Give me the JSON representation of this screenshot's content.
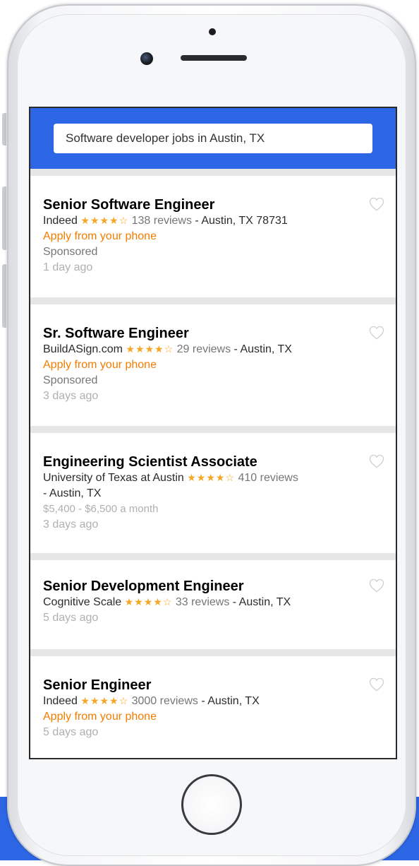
{
  "search": {
    "query": "Software developer jobs in Austin, TX"
  },
  "jobs": [
    {
      "title": "Senior Software Engineer",
      "company": "Indeed",
      "stars": "★★★★☆",
      "reviews": "138 reviews",
      "location": " - Austin, TX 78731",
      "apply": "Apply from your phone",
      "sponsored": "Sponsored",
      "posted": "1 day ago"
    },
    {
      "title": "Sr. Software Engineer",
      "company": "BuildASign.com",
      "stars": "★★★★☆",
      "reviews": "29 reviews",
      "location": " - Austin, TX",
      "apply": "Apply from your phone",
      "sponsored": "Sponsored",
      "posted": "3 days ago"
    },
    {
      "title": "Engineering Scientist Associate",
      "company": "University of Texas at Austin",
      "stars": "★★★★☆",
      "reviews": "410 reviews",
      "location": "- Austin, TX",
      "salary": "$5,400 - $6,500 a month",
      "posted": "3 days ago"
    },
    {
      "title": "Senior Development Engineer",
      "company": "Cognitive Scale",
      "stars": "★★★★☆",
      "reviews": "33 reviews",
      "location": " - Austin, TX",
      "posted": "5 days ago"
    },
    {
      "title": "Senior Engineer",
      "company": "Indeed",
      "stars": "★★★★☆",
      "reviews": "3000 reviews",
      "location": " - Austin, TX",
      "apply": "Apply from your phone",
      "posted": "5 days ago"
    }
  ],
  "icons": {
    "favorite": "heart-outline-icon"
  },
  "colors": {
    "brand_blue": "#2d66e4",
    "apply_orange": "#f57c00",
    "star_gold": "#f5a623",
    "muted_gray": "#b0b0b0"
  }
}
